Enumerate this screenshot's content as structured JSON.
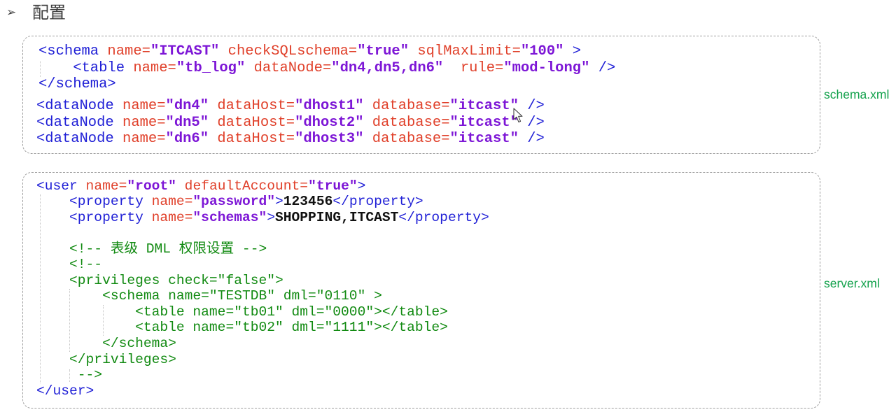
{
  "heading": {
    "bullet": "➢",
    "title": "配置"
  },
  "colors": {
    "tag": "#1f1fd6",
    "attr": "#e0402a",
    "val": "#7d16d6",
    "text": "#111111",
    "comment": "#118a11",
    "label": "#12a14b",
    "heading": "#3c3c3c"
  },
  "icons": {
    "bullet": "arrow-bullet-icon",
    "cursor": "mouse-pointer-icon"
  },
  "schema_xml": {
    "label": "schema.xml",
    "blocks": [
      {
        "lines": [
          [
            {
              "t": "<schema",
              "c": "tag"
            },
            {
              "t": " name=",
              "c": "attr"
            },
            {
              "t": "\"ITCAST\"",
              "c": "val"
            },
            {
              "t": " checkSQLschema=",
              "c": "attr"
            },
            {
              "t": "\"true\"",
              "c": "val"
            },
            {
              "t": " sqlMaxLimit=",
              "c": "attr"
            },
            {
              "t": "\"100\"",
              "c": "val"
            },
            {
              "t": " >",
              "c": "tag"
            }
          ],
          [
            {
              "t": "    <table",
              "c": "tag"
            },
            {
              "t": " name=",
              "c": "attr"
            },
            {
              "t": "\"tb_log\"",
              "c": "val"
            },
            {
              "t": " dataNode=",
              "c": "attr"
            },
            {
              "t": "\"dn4,dn5,dn6\"",
              "c": "val"
            },
            {
              "t": "  rule=",
              "c": "attr"
            },
            {
              "t": "\"mod-long\"",
              "c": "val"
            },
            {
              "t": " />",
              "c": "tag"
            }
          ],
          [
            {
              "t": "</schema>",
              "c": "tag"
            }
          ]
        ]
      },
      {
        "lines": [
          [
            {
              "t": "<dataNode",
              "c": "tag"
            },
            {
              "t": " name=",
              "c": "attr"
            },
            {
              "t": "\"dn4\"",
              "c": "val"
            },
            {
              "t": " dataHost=",
              "c": "attr"
            },
            {
              "t": "\"dhost1\"",
              "c": "val"
            },
            {
              "t": " database=",
              "c": "attr"
            },
            {
              "t": "\"itcast\"",
              "c": "val"
            },
            {
              "t": " />",
              "c": "tag"
            }
          ],
          [
            {
              "t": "<dataNode",
              "c": "tag"
            },
            {
              "t": " name=",
              "c": "attr"
            },
            {
              "t": "\"dn5\"",
              "c": "val"
            },
            {
              "t": " dataHost=",
              "c": "attr"
            },
            {
              "t": "\"dhost2\"",
              "c": "val"
            },
            {
              "t": " database=",
              "c": "attr"
            },
            {
              "t": "\"itcast\"",
              "c": "val"
            },
            {
              "t": " />",
              "c": "tag"
            }
          ],
          [
            {
              "t": "<dataNode",
              "c": "tag"
            },
            {
              "t": " name=",
              "c": "attr"
            },
            {
              "t": "\"dn6\"",
              "c": "val"
            },
            {
              "t": " dataHost=",
              "c": "attr"
            },
            {
              "t": "\"dhost3\"",
              "c": "val"
            },
            {
              "t": " database=",
              "c": "attr"
            },
            {
              "t": "\"itcast\"",
              "c": "val"
            },
            {
              "t": " />",
              "c": "tag"
            }
          ]
        ]
      }
    ]
  },
  "server_xml": {
    "label": "server.xml",
    "blocks": [
      {
        "lines": [
          [
            {
              "t": "<user",
              "c": "tag"
            },
            {
              "t": " name=",
              "c": "attr"
            },
            {
              "t": "\"root\"",
              "c": "val"
            },
            {
              "t": " defaultAccount=",
              "c": "attr"
            },
            {
              "t": "\"true\"",
              "c": "val"
            },
            {
              "t": ">",
              "c": "tag"
            }
          ],
          [
            {
              "t": "    <property",
              "c": "tag"
            },
            {
              "t": " name=",
              "c": "attr"
            },
            {
              "t": "\"password\"",
              "c": "val"
            },
            {
              "t": ">",
              "c": "tag"
            },
            {
              "t": "123456",
              "c": "text"
            },
            {
              "t": "</property>",
              "c": "tag"
            }
          ],
          [
            {
              "t": "    <property",
              "c": "tag"
            },
            {
              "t": " name=",
              "c": "attr"
            },
            {
              "t": "\"schemas\"",
              "c": "val"
            },
            {
              "t": ">",
              "c": "tag"
            },
            {
              "t": "SHOPPING,ITCAST",
              "c": "text"
            },
            {
              "t": "</property>",
              "c": "tag"
            }
          ],
          [],
          [
            {
              "t": "    <!-- 表级 DML 权限设置 -->",
              "c": "comment"
            }
          ],
          [
            {
              "t": "    <!--",
              "c": "comment"
            }
          ],
          [
            {
              "t": "    <privileges check=\"false\">",
              "c": "comment"
            }
          ],
          [
            {
              "t": "        <schema name=\"TESTDB\" dml=\"0110\" >",
              "c": "comment"
            }
          ],
          [
            {
              "t": "            <table name=\"tb01\" dml=\"0000\"></table>",
              "c": "comment"
            }
          ],
          [
            {
              "t": "            <table name=\"tb02\" dml=\"1111\"></table>",
              "c": "comment"
            }
          ],
          [
            {
              "t": "        </schema>",
              "c": "comment"
            }
          ],
          [
            {
              "t": "    </privileges>",
              "c": "comment"
            }
          ],
          [
            {
              "t": "     -->",
              "c": "comment"
            }
          ],
          [
            {
              "t": "</user>",
              "c": "tag"
            }
          ]
        ]
      }
    ]
  }
}
